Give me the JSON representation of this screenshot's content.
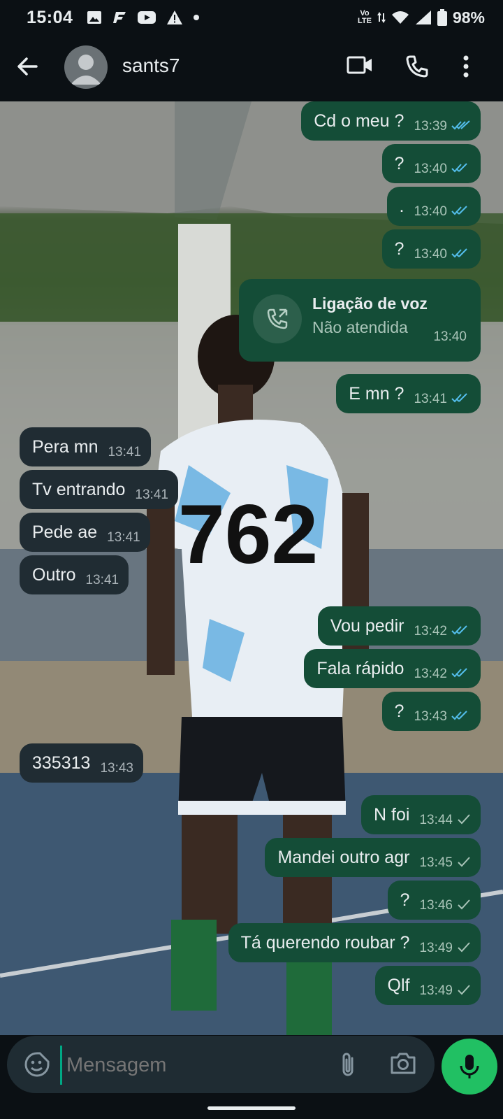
{
  "status_bar": {
    "time": "15:04",
    "network_top": "Vo",
    "network_bottom": "LTE",
    "battery": "98%"
  },
  "header": {
    "contact_name": "sants7"
  },
  "messages": [
    {
      "dir": "out",
      "text": "Cd o meu ?",
      "time": "13:39",
      "status": "read"
    },
    {
      "dir": "out",
      "text": "?",
      "time": "13:40",
      "status": "read"
    },
    {
      "dir": "out",
      "text": ".",
      "time": "13:40",
      "status": "read"
    },
    {
      "dir": "out",
      "text": "?",
      "time": "13:40",
      "status": "read"
    },
    {
      "dir": "out",
      "text": "E mn ?",
      "time": "13:41",
      "status": "read"
    },
    {
      "dir": "in",
      "text": "Pera mn",
      "time": "13:41"
    },
    {
      "dir": "in",
      "text": "Tv entrando",
      "time": "13:41"
    },
    {
      "dir": "in",
      "text": "Pede ae",
      "time": "13:41"
    },
    {
      "dir": "in",
      "text": "Outro",
      "time": "13:41"
    },
    {
      "dir": "out",
      "text": "Vou pedir",
      "time": "13:42",
      "status": "read"
    },
    {
      "dir": "out",
      "text": "Fala rápido",
      "time": "13:42",
      "status": "read"
    },
    {
      "dir": "out",
      "text": "?",
      "time": "13:43",
      "status": "read"
    },
    {
      "dir": "in",
      "text": "335313",
      "time": "13:43"
    },
    {
      "dir": "out",
      "text": "N foi",
      "time": "13:44",
      "status": "sent"
    },
    {
      "dir": "out",
      "text": "Mandei outro agr",
      "time": "13:45",
      "status": "sent"
    },
    {
      "dir": "out",
      "text": "?",
      "time": "13:46",
      "status": "sent"
    },
    {
      "dir": "out",
      "text": "Tá querendo roubar ?",
      "time": "13:49",
      "status": "sent"
    },
    {
      "dir": "out",
      "text": "Qlf",
      "time": "13:49",
      "status": "sent"
    }
  ],
  "call": {
    "title": "Ligação de voz",
    "subtitle": "Não atendida",
    "time": "13:40"
  },
  "composer": {
    "placeholder": "Mensagem"
  },
  "colors": {
    "outgoing_bubble": "#144d37",
    "incoming_bubble": "#202c33",
    "read_tick": "#53bdeb",
    "mic_button": "#21c063"
  }
}
